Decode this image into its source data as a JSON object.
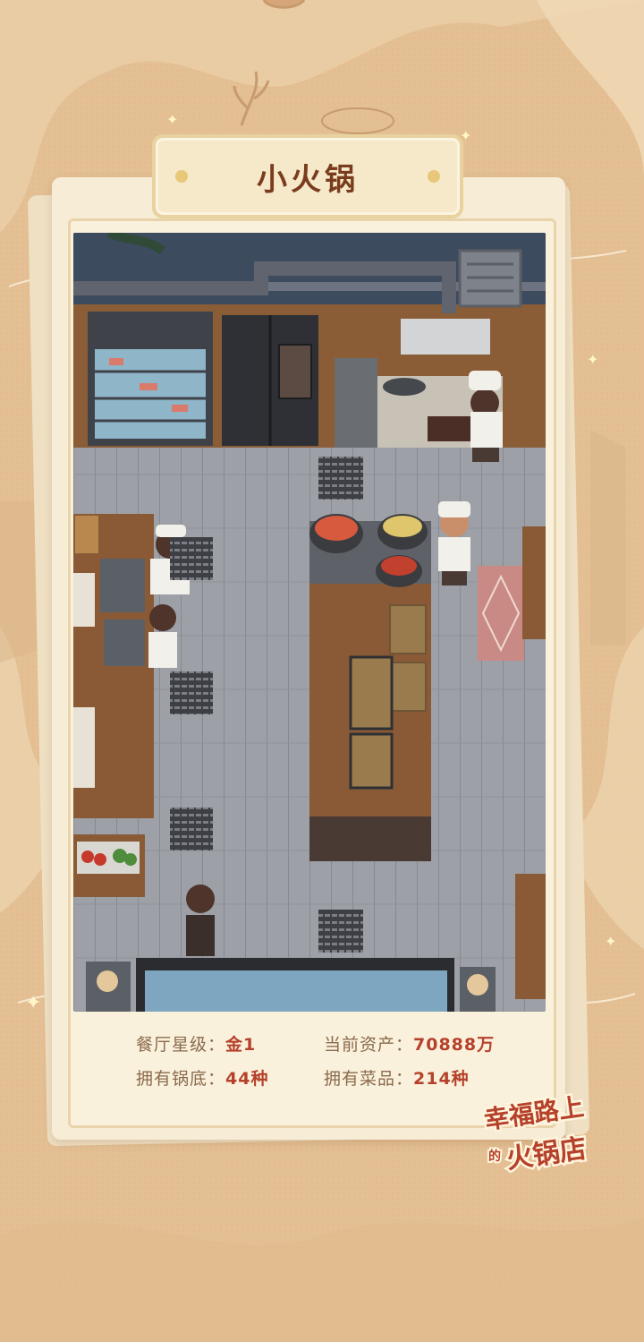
{
  "restaurant_name": "小火锅",
  "stats": {
    "star_label": "餐厅星级：",
    "star_value": "金1",
    "assets_label": "当前资产：",
    "assets_value": "70888万",
    "pot_label": "拥有锅底：",
    "pot_value": "44种",
    "dish_label": "拥有菜品：",
    "dish_value": "214种"
  },
  "logo": {
    "line1": "幸福路上",
    "line2_small": "的",
    "line2": "火锅店"
  },
  "colors": {
    "background": "#e3bf93",
    "card": "#f7ecd6",
    "title_text": "#7a3c1e",
    "value_text": "#b5412a",
    "floor": "#9a9da3",
    "counter_wood": "#8a5a36"
  }
}
